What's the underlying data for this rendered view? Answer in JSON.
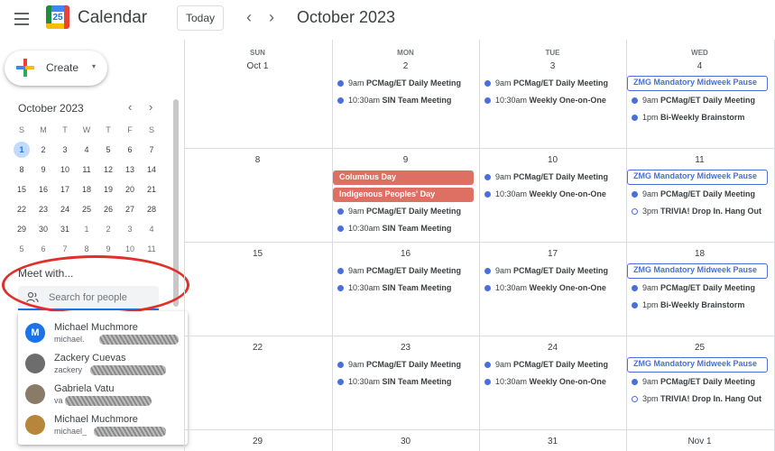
{
  "app": {
    "title": "Calendar",
    "logo_day": "25"
  },
  "header": {
    "today_label": "Today",
    "prev_icon": "‹",
    "next_icon": "›",
    "current_month": "October 2023"
  },
  "sidebar": {
    "create_label": "Create",
    "create_caret": "▾",
    "mini_calendar": {
      "title": "October 2023",
      "prev_icon": "‹",
      "next_icon": "›",
      "dow": [
        "S",
        "M",
        "T",
        "W",
        "T",
        "F",
        "S"
      ],
      "weeks": [
        [
          "1",
          "2",
          "3",
          "4",
          "5",
          "6",
          "7"
        ],
        [
          "8",
          "9",
          "10",
          "11",
          "12",
          "13",
          "14"
        ],
        [
          "15",
          "16",
          "17",
          "18",
          "19",
          "20",
          "21"
        ],
        [
          "22",
          "23",
          "24",
          "25",
          "26",
          "27",
          "28"
        ],
        [
          "29",
          "30",
          "31",
          "1",
          "2",
          "3",
          "4"
        ],
        [
          "5",
          "6",
          "7",
          "8",
          "9",
          "10",
          "11"
        ]
      ],
      "today": "1"
    },
    "meet_with": {
      "title": "Meet with...",
      "search_placeholder": "Search for people",
      "suggestions": [
        {
          "name": "Michael Muchmore",
          "email": "michael.",
          "avatar": "M",
          "avatar_color": "#1a73e8"
        },
        {
          "name": "Zackery Cuevas",
          "email": "zackery",
          "avatar": "",
          "avatar_color": "#6d6d6d"
        },
        {
          "name": "Gabriela Vatu",
          "email": "va",
          "avatar": "",
          "avatar_color": "#8a7a68"
        },
        {
          "name": "Michael Muchmore",
          "email": "michael_",
          "avatar": "",
          "avatar_color": "#b8863b"
        }
      ]
    }
  },
  "grid": {
    "day_headers": [
      "SUN",
      "MON",
      "TUE",
      "WED"
    ],
    "weeks": [
      {
        "dates": [
          "Oct 1",
          "2",
          "3",
          "4"
        ]
      },
      {
        "dates": [
          "8",
          "9",
          "10",
          "11"
        ]
      },
      {
        "dates": [
          "15",
          "16",
          "17",
          "18"
        ]
      },
      {
        "dates": [
          "22",
          "23",
          "24",
          "25"
        ]
      },
      {
        "dates": [
          "29",
          "30",
          "31",
          "Nov 1"
        ]
      }
    ],
    "events": {
      "pcmag_time": "9am",
      "pcmag_title": "PCMag/ET Daily Meeting",
      "sin_time": "10:30am",
      "sin_title": "SIN Team Meeting",
      "weekly_time": "10:30am",
      "weekly_title": "Weekly One-on-One",
      "zmg_title": "ZMG Mandatory Midweek Pause",
      "brainstorm_time": "1pm",
      "brainstorm_title": "Bi-Weekly Brainstorm",
      "trivia_time": "3pm",
      "trivia_title": "TRIVIA! Drop In. Hang Out",
      "columbus": "Columbus Day",
      "indigenous": "Indigenous Peoples' Day"
    }
  },
  "colors": {
    "accent": "#1a73e8",
    "event_dot": "#4a6fd6",
    "holiday": "#dd6f63",
    "highlight_annotation": "#e0302a"
  }
}
